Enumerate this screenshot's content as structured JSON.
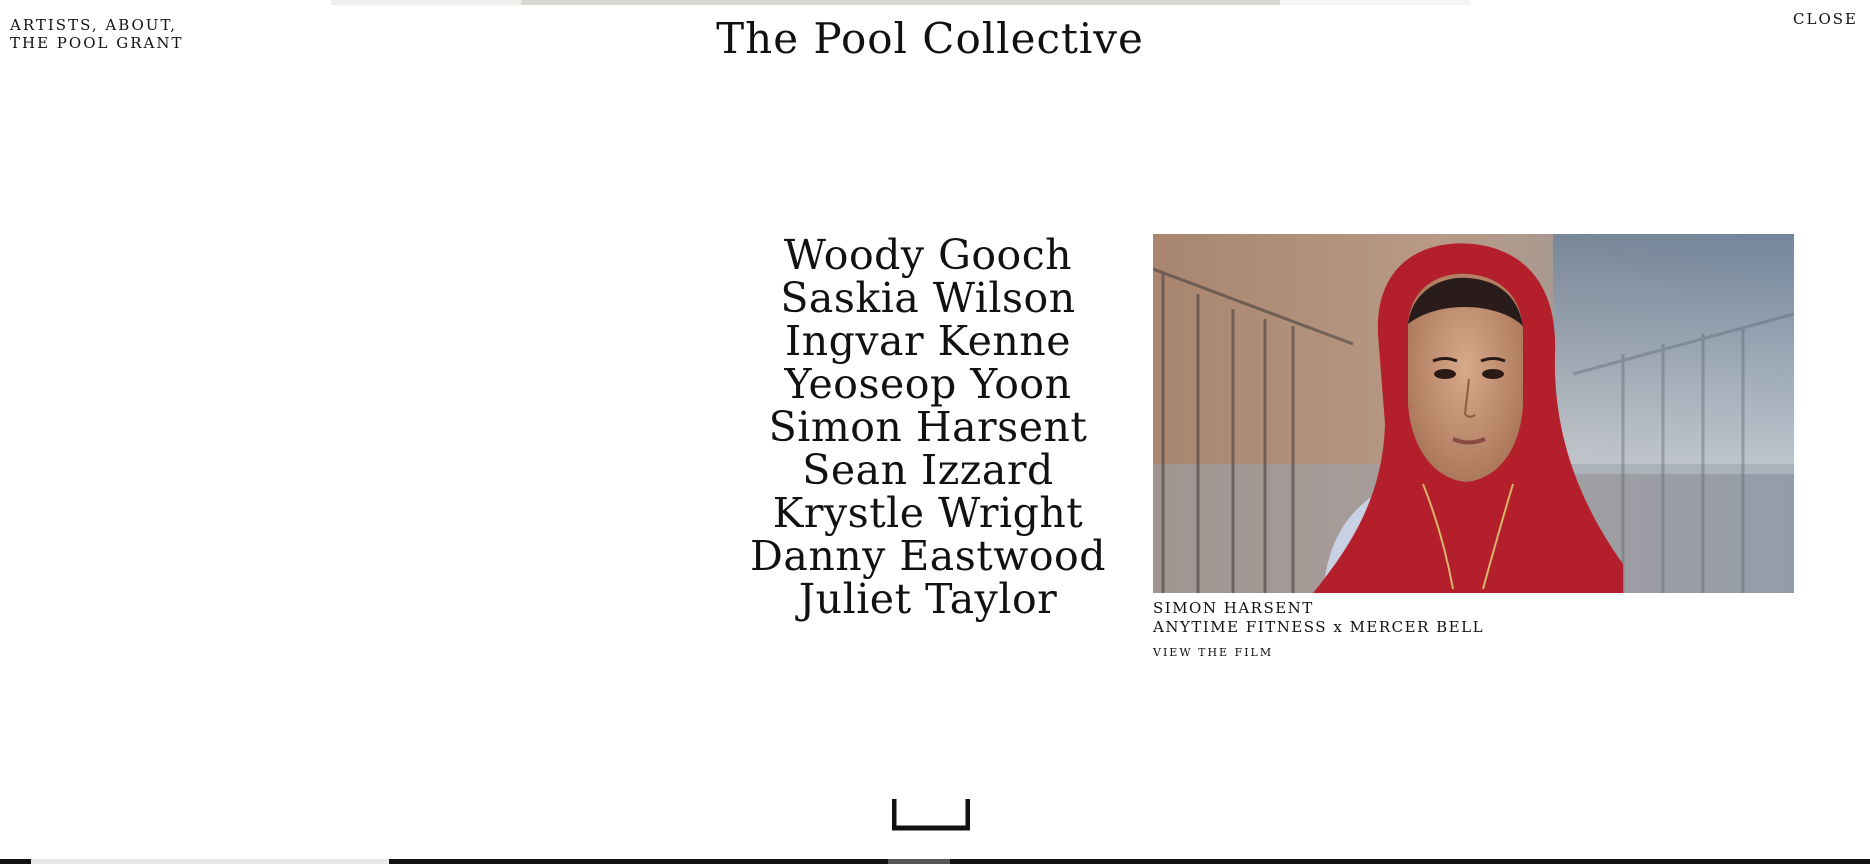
{
  "nav": {
    "artists": "ARTISTS,",
    "about": "ABOUT,",
    "grant": "THE POOL GRANT"
  },
  "close_label": "CLOSE",
  "title": "The Pool Collective",
  "artists": [
    "Woody Gooch",
    "Saskia Wilson",
    "Ingvar Kenne",
    "Yeoseop Yoon",
    "Simon Harsent",
    "Sean Izzard",
    "Krystle Wright",
    "Danny Eastwood",
    "Juliet Taylor"
  ],
  "feature": {
    "artist": "SIMON HARSENT",
    "project": "ANYTIME FITNESS x MERCER BELL",
    "cta": "VIEW THE FILM"
  },
  "colors": {
    "background": "#ffffff",
    "text": "#111111",
    "hijab_red": "#b3202b"
  },
  "icons": {
    "bottom": "bracket-icon"
  }
}
